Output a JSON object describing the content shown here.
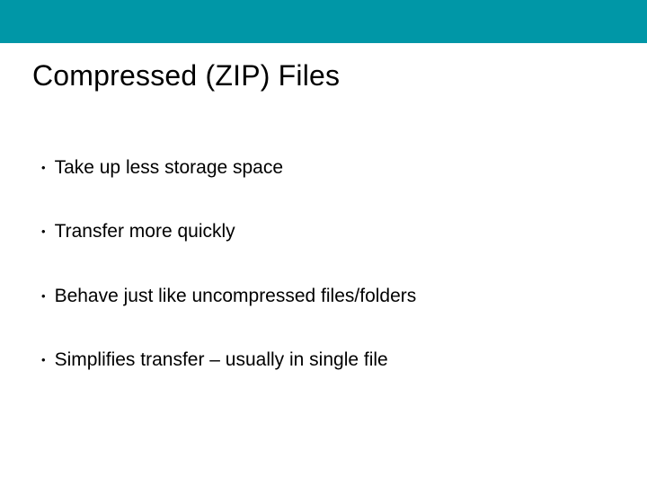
{
  "accent_color": "#0097a7",
  "title": "Compressed (ZIP) Files",
  "bullets": [
    {
      "text": "Take up less storage space"
    },
    {
      "text": "Transfer more quickly"
    },
    {
      "text": "Behave just like uncompressed files/folders"
    },
    {
      "text": "Simplifies transfer – usually in single file"
    }
  ]
}
